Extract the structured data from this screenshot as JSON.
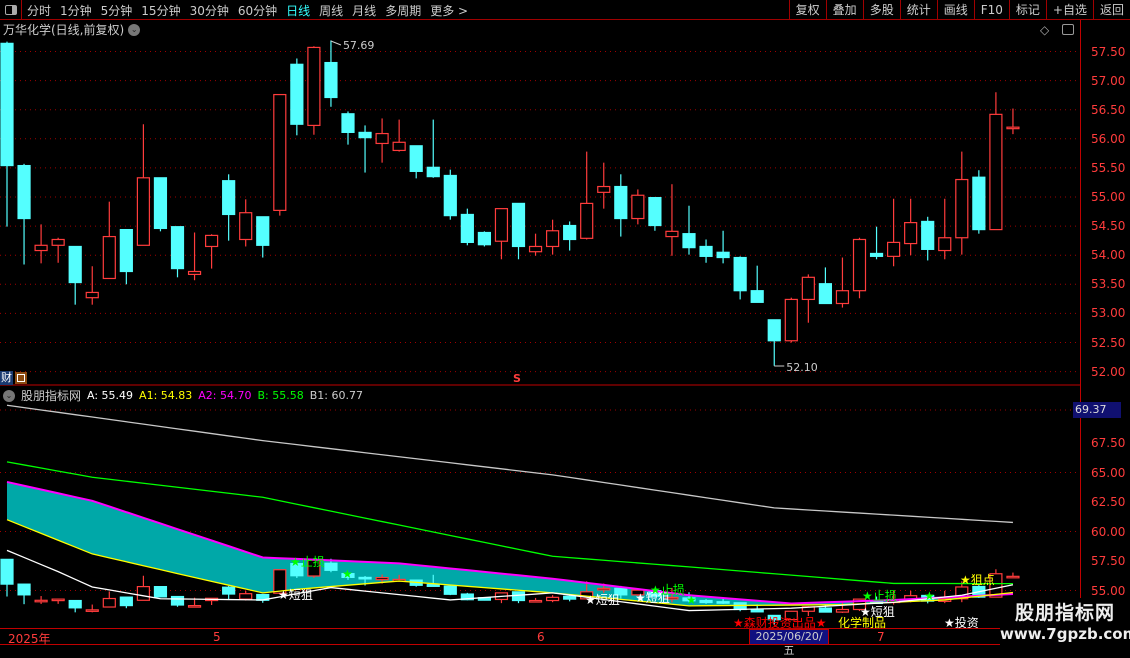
{
  "toolbar": {
    "periods": [
      "分时",
      "1分钟",
      "5分钟",
      "15分钟",
      "30分钟",
      "60分钟",
      "日线",
      "周线",
      "月线",
      "多周期",
      "更多 >"
    ],
    "active_period": "日线",
    "buttons": [
      "复权",
      "叠加",
      "多股",
      "统计",
      "画线",
      "F10",
      "标记",
      "+自选",
      "返回"
    ]
  },
  "header": {
    "title": "万华化学(日线,前复权)",
    "diamond": "◇"
  },
  "finance": {
    "label": "财"
  },
  "indicator": {
    "name": "股朋指标网",
    "A": "A: 55.49",
    "A1": "A1: 54.83",
    "A2": "A2: 54.70",
    "B": "B: 55.58",
    "B1": "B1: 60.77",
    "current": "69.37"
  },
  "price_axis": [
    "57.50",
    "57.00",
    "56.50",
    "56.00",
    "55.50",
    "55.00",
    "54.50",
    "54.00",
    "53.50",
    "53.00",
    "52.50",
    "52.00"
  ],
  "ind_axis": [
    "67.50",
    "65.00",
    "62.50",
    "60.00",
    "57.50",
    "55.00"
  ],
  "dates": {
    "year": "2025年",
    "m5": "5",
    "m6": "6",
    "m7": "7",
    "cursor": "2025/06/20/五"
  },
  "markers": {
    "high": "57.69",
    "low": "52.10",
    "s": "S"
  },
  "signals": {
    "short": "★短狙",
    "stop": "★止损",
    "snipe": "★狙点",
    "brand": "★森财投资出品★",
    "sector": "化学制品",
    "invest": "★投资"
  },
  "watermark": {
    "name": "股朋指标网",
    "url": "www.7gpzb.com"
  },
  "colors": {
    "up": "#ff3c3c",
    "down": "#54ffff",
    "A": "#ffffff",
    "A1": "#ffff00",
    "A2": "#ff00ff",
    "B": "#00ff00",
    "B1": "#c8c8c8",
    "fill": "#00a8a8"
  },
  "chart_data": {
    "type": "candlestick",
    "title": "万华化学(日线,前复权)",
    "ylim": [
      52.0,
      57.5
    ],
    "candles_ohlc": [
      [
        57.64,
        57.67,
        54.49,
        55.54
      ],
      [
        55.54,
        55.57,
        53.84,
        54.63
      ],
      [
        54.08,
        54.53,
        53.86,
        54.17
      ],
      [
        54.17,
        54.3,
        53.87,
        54.27
      ],
      [
        54.15,
        54.15,
        53.15,
        53.53
      ],
      [
        53.27,
        53.81,
        53.15,
        53.36
      ],
      [
        53.6,
        54.92,
        53.6,
        54.32
      ],
      [
        54.44,
        54.44,
        53.5,
        53.72
      ],
      [
        54.17,
        56.25,
        54.17,
        55.33
      ],
      [
        55.33,
        55.33,
        54.41,
        54.46
      ],
      [
        54.49,
        54.49,
        53.62,
        53.77
      ],
      [
        53.67,
        54.39,
        53.57,
        53.72
      ],
      [
        54.15,
        54.36,
        53.77,
        54.34
      ],
      [
        55.28,
        55.39,
        54.25,
        54.7
      ],
      [
        54.27,
        54.96,
        54.15,
        54.73
      ],
      [
        54.66,
        54.66,
        53.96,
        54.17
      ],
      [
        54.77,
        56.76,
        54.68,
        56.76
      ],
      [
        57.28,
        57.38,
        56.06,
        56.25
      ],
      [
        56.23,
        57.59,
        56.07,
        57.57
      ],
      [
        57.31,
        57.69,
        56.55,
        56.71
      ],
      [
        56.43,
        56.47,
        55.9,
        56.11
      ],
      [
        56.11,
        56.23,
        55.42,
        56.02
      ],
      [
        55.92,
        56.35,
        55.59,
        56.09
      ],
      [
        55.8,
        56.33,
        55.78,
        55.94
      ],
      [
        55.88,
        55.88,
        55.32,
        55.44
      ],
      [
        55.51,
        56.33,
        55.33,
        55.35
      ],
      [
        55.37,
        55.47,
        54.61,
        54.68
      ],
      [
        54.7,
        54.8,
        54.17,
        54.22
      ],
      [
        54.39,
        54.41,
        54.15,
        54.18
      ],
      [
        54.24,
        54.8,
        53.93,
        54.8
      ],
      [
        54.89,
        54.89,
        53.93,
        54.15
      ],
      [
        54.06,
        54.37,
        53.99,
        54.15
      ],
      [
        54.15,
        54.61,
        54.01,
        54.42
      ],
      [
        54.51,
        54.58,
        54.08,
        54.27
      ],
      [
        54.29,
        55.78,
        54.27,
        54.89
      ],
      [
        55.08,
        55.59,
        54.8,
        55.18
      ],
      [
        55.18,
        55.39,
        54.32,
        54.63
      ],
      [
        54.63,
        55.13,
        54.53,
        55.03
      ],
      [
        54.99,
        54.99,
        54.42,
        54.51
      ],
      [
        54.32,
        55.22,
        53.99,
        54.41
      ],
      [
        54.37,
        54.85,
        54.01,
        54.13
      ],
      [
        54.15,
        54.27,
        53.87,
        53.98
      ],
      [
        54.05,
        54.42,
        53.86,
        53.96
      ],
      [
        53.96,
        53.98,
        53.24,
        53.39
      ],
      [
        53.39,
        53.82,
        53.19,
        53.19
      ],
      [
        52.89,
        52.89,
        52.1,
        52.53
      ],
      [
        52.53,
        53.27,
        52.5,
        53.24
      ],
      [
        53.24,
        53.67,
        52.84,
        53.62
      ],
      [
        53.51,
        53.79,
        53.17,
        53.17
      ],
      [
        53.17,
        53.96,
        53.1,
        53.39
      ],
      [
        53.39,
        54.3,
        53.26,
        54.27
      ],
      [
        54.03,
        54.49,
        53.93,
        53.98
      ],
      [
        53.98,
        54.97,
        53.81,
        54.22
      ],
      [
        54.2,
        54.97,
        54.0,
        54.56
      ],
      [
        54.58,
        54.66,
        53.91,
        54.1
      ],
      [
        54.08,
        54.97,
        53.93,
        54.3
      ],
      [
        54.3,
        55.78,
        54.01,
        55.3
      ],
      [
        55.34,
        55.46,
        54.37,
        54.44
      ],
      [
        54.44,
        56.8,
        54.44,
        56.42
      ],
      [
        56.2,
        56.52,
        56.08,
        56.2
      ]
    ],
    "indicator_ylim": [
      53.0,
      70.0
    ],
    "indicator_series_index_value": {
      "B1": [
        [
          0,
          70.7
        ],
        [
          15,
          67.7
        ],
        [
          32,
          64.8
        ],
        [
          45,
          62.0
        ],
        [
          59,
          60.77
        ]
      ],
      "B": [
        [
          0,
          65.9
        ],
        [
          5,
          64.6
        ],
        [
          15,
          62.9
        ],
        [
          32,
          57.9
        ],
        [
          40,
          57.0
        ],
        [
          52,
          55.6
        ],
        [
          59,
          55.58
        ]
      ],
      "A2": [
        [
          0,
          64.2
        ],
        [
          5,
          62.6
        ],
        [
          10,
          60.2
        ],
        [
          15,
          57.8
        ],
        [
          23,
          57.3
        ],
        [
          32,
          56.0
        ],
        [
          40,
          54.6
        ],
        [
          46,
          53.9
        ],
        [
          52,
          54.2
        ],
        [
          59,
          54.7
        ]
      ],
      "A1": [
        [
          0,
          61.0
        ],
        [
          5,
          58.1
        ],
        [
          11,
          56.1
        ],
        [
          15,
          54.8
        ],
        [
          17,
          55.1
        ],
        [
          23,
          55.8
        ],
        [
          32,
          54.8
        ],
        [
          40,
          53.7
        ],
        [
          49,
          53.8
        ],
        [
          55,
          54.2
        ],
        [
          59,
          54.83
        ]
      ],
      "A": [
        [
          0,
          58.4
        ],
        [
          3,
          56.6
        ],
        [
          5,
          55.3
        ],
        [
          9,
          54.3
        ],
        [
          15,
          54.2
        ],
        [
          19,
          55.25
        ],
        [
          26,
          54.2
        ],
        [
          32,
          54.8
        ],
        [
          40,
          53.3
        ],
        [
          46,
          53.5
        ],
        [
          52,
          54.0
        ],
        [
          56,
          54.6
        ],
        [
          59,
          55.49
        ]
      ]
    }
  }
}
